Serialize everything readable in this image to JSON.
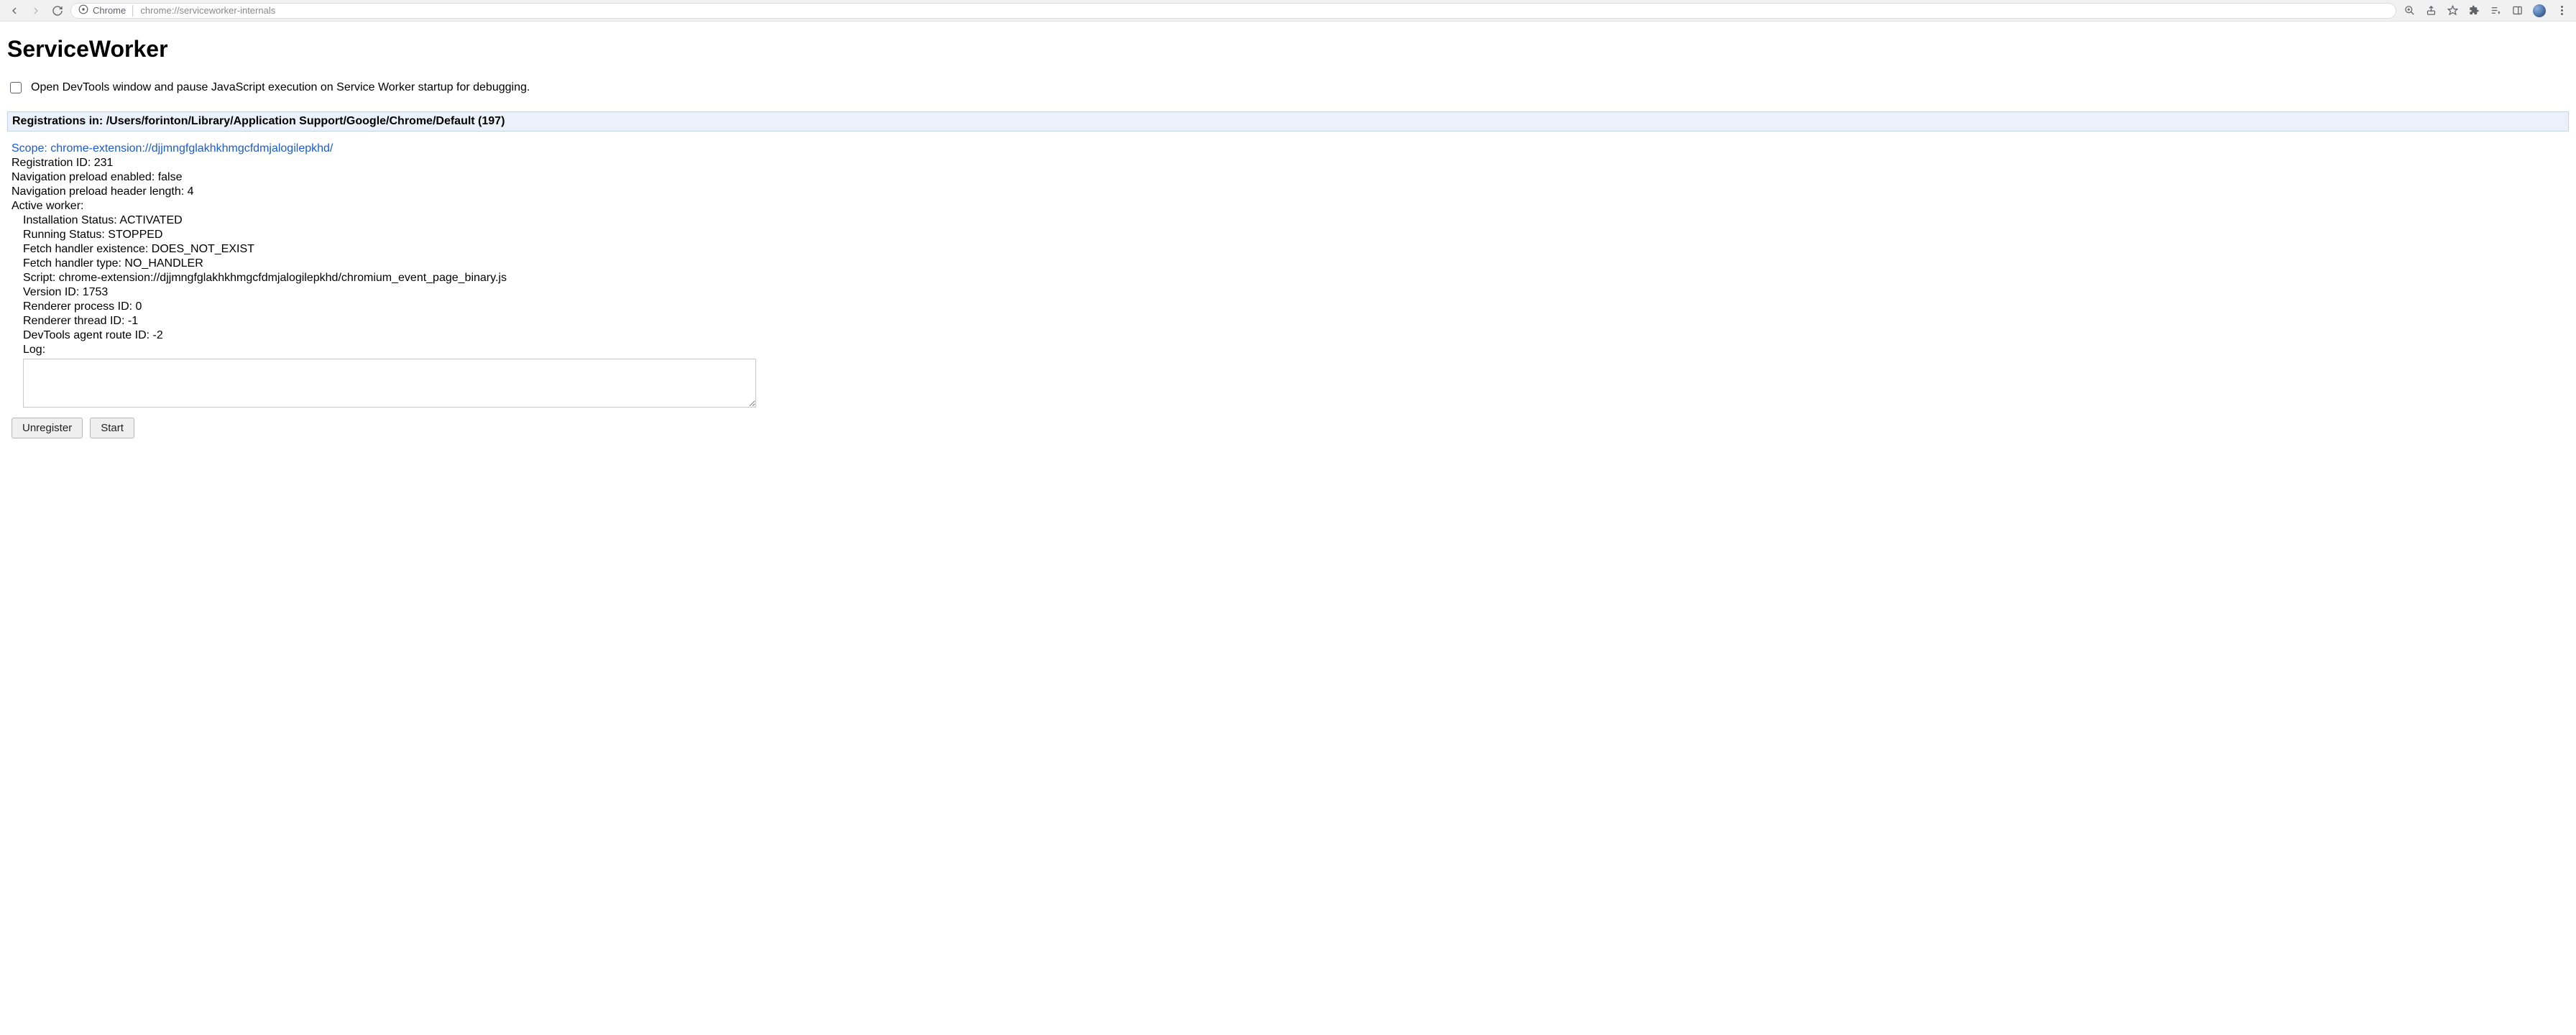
{
  "chrome": {
    "host_label": "Chrome",
    "url": "chrome://serviceworker-internals"
  },
  "page": {
    "title": "ServiceWorker",
    "debug_checkbox_label": "Open DevTools window and pause JavaScript execution on Service Worker startup for debugging."
  },
  "section": {
    "header_prefix": "Registrations in: ",
    "profile_path": "/Users/forinton/Library/Application Support/Google/Chrome/Default",
    "count_suffix": " (197)"
  },
  "entry": {
    "scope_prefix": "Scope: ",
    "scope_url": "chrome-extension://djjmngfglakhkhmgcfdmjalogilepkhd/",
    "registration_id_label": "Registration ID: ",
    "registration_id": "231",
    "nav_preload_enabled_label": "Navigation preload enabled: ",
    "nav_preload_enabled": "false",
    "nav_preload_header_len_label": "Navigation preload header length: ",
    "nav_preload_header_len": "4",
    "active_worker_label": "Active worker:",
    "install_status_label": "Installation Status: ",
    "install_status": "ACTIVATED",
    "running_status_label": "Running Status: ",
    "running_status": "STOPPED",
    "fetch_existence_label": "Fetch handler existence: ",
    "fetch_existence": "DOES_NOT_EXIST",
    "fetch_type_label": "Fetch handler type: ",
    "fetch_type": "NO_HANDLER",
    "script_label": "Script: ",
    "script": "chrome-extension://djjmngfglakhkhmgcfdmjalogilepkhd/chromium_event_page_binary.js",
    "version_id_label": "Version ID: ",
    "version_id": "1753",
    "renderer_pid_label": "Renderer process ID: ",
    "renderer_pid": "0",
    "renderer_tid_label": "Renderer thread ID: ",
    "renderer_tid": "-1",
    "devtools_route_label": "DevTools agent route ID: ",
    "devtools_route": "-2",
    "log_label": "Log:",
    "log_value": ""
  },
  "buttons": {
    "unregister": "Unregister",
    "start": "Start"
  }
}
